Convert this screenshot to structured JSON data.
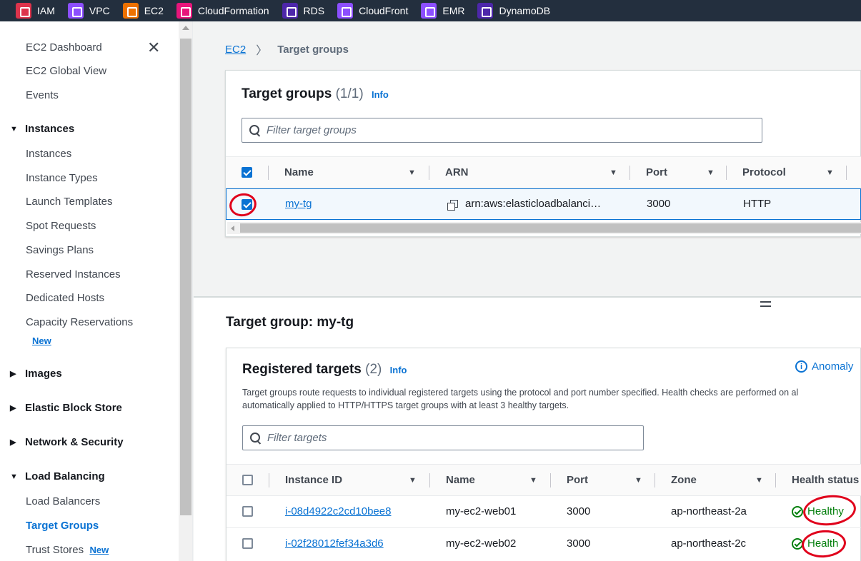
{
  "topbar": {
    "services": [
      {
        "label": "IAM",
        "color": "#dd344c"
      },
      {
        "label": "VPC",
        "color": "#8c4fff"
      },
      {
        "label": "EC2",
        "color": "#ed7100"
      },
      {
        "label": "CloudFormation",
        "color": "#e7157b"
      },
      {
        "label": "RDS",
        "color": "#4d27aa"
      },
      {
        "label": "CloudFront",
        "color": "#8c4fff"
      },
      {
        "label": "EMR",
        "color": "#8c4fff"
      },
      {
        "label": "DynamoDB",
        "color": "#4d27aa"
      }
    ]
  },
  "sidebar": {
    "close_label": "✕",
    "top_items": [
      "EC2 Dashboard",
      "EC2 Global View",
      "Events"
    ],
    "instances_header": "Instances",
    "instances_items": [
      "Instances",
      "Instance Types",
      "Launch Templates",
      "Spot Requests",
      "Savings Plans",
      "Reserved Instances",
      "Dedicated Hosts",
      "Capacity Reservations"
    ],
    "new_badge": "New",
    "images_header": "Images",
    "ebs_header": "Elastic Block Store",
    "network_header": "Network & Security",
    "lb_header": "Load Balancing",
    "lb_items": [
      "Load Balancers",
      "Target Groups",
      "Trust Stores"
    ]
  },
  "breadcrumb": {
    "root": "EC2",
    "current": "Target groups"
  },
  "target_groups": {
    "title": "Target groups",
    "count": "(1/1)",
    "info": "Info",
    "filter_placeholder": "Filter target groups",
    "columns": [
      "Name",
      "ARN",
      "Port",
      "Protocol"
    ],
    "rows": [
      {
        "name": "my-tg",
        "arn": "arn:aws:elasticloadbalanci…",
        "port": "3000",
        "protocol": "HTTP",
        "selected": true
      }
    ]
  },
  "detail": {
    "title": "Target group: my-tg"
  },
  "registered_targets": {
    "title": "Registered targets",
    "count": "(2)",
    "info": "Info",
    "anomaly_label": "Anomaly",
    "description_line1": "Target groups route requests to individual registered targets using the protocol and port number specified. Health checks are performed on al",
    "description_line2": "automatically applied to HTTP/HTTPS target groups with at least 3 healthy targets.",
    "filter_placeholder": "Filter targets",
    "columns": [
      "Instance ID",
      "Name",
      "Port",
      "Zone",
      "Health status"
    ],
    "rows": [
      {
        "instance_id": "i-08d4922c2cd10bee8",
        "name": "my-ec2-web01",
        "port": "3000",
        "zone": "ap-northeast-2a",
        "health": "Healthy"
      },
      {
        "instance_id": "i-02f28012fef34a3d6",
        "name": "my-ec2-web02",
        "port": "3000",
        "zone": "ap-northeast-2c",
        "health": "Health"
      }
    ]
  },
  "colors": {
    "accent": "#0972d3",
    "healthy": "#037f0c",
    "annotation": "#e0001b"
  }
}
